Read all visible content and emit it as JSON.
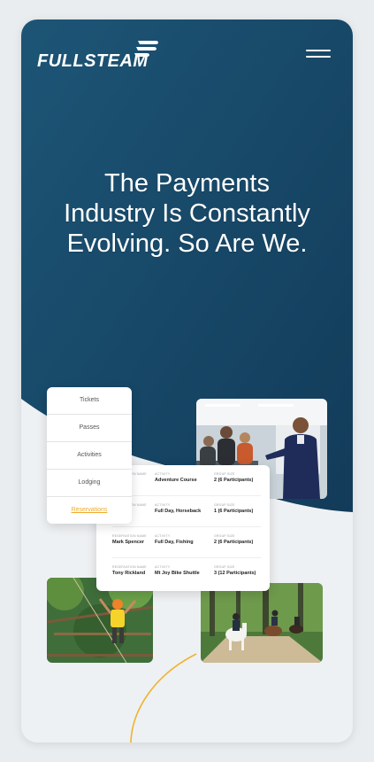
{
  "brand": {
    "logo_text": "FULLSTEAM"
  },
  "hero": {
    "headline": "The Payments Industry Is Constantly Evolving. So Are We."
  },
  "menu_card": {
    "items": [
      {
        "label": "Tickets"
      },
      {
        "label": "Passes"
      },
      {
        "label": "Activities"
      },
      {
        "label": "Lodging"
      },
      {
        "label": "Reservations",
        "active": true
      }
    ]
  },
  "reservations": {
    "caption_name": "RESERVATION NAME",
    "caption_activity": "ACTIVITY",
    "caption_group": "GROUP SIZE",
    "rows": [
      {
        "name": "",
        "activity": "Adventure Course",
        "group": "2 (6 Participants)"
      },
      {
        "name": "",
        "activity": "Full Day, Horseback",
        "group": "1 (6 Participants)"
      },
      {
        "name": "Mark Spencer",
        "activity": "Full Day, Fishing",
        "group": "2 (6 Participants)"
      },
      {
        "name": "Tony Rickland",
        "activity": "Mt Joy Bike Shuttle",
        "group": "3 (12 Participants)"
      }
    ]
  },
  "icons": {
    "menu": "hamburger-menu-icon",
    "logo_mark": "flag-logo-icon"
  },
  "colors": {
    "hero_top": "#1d5576",
    "hero_bottom": "#133e5c",
    "accent": "#f0a92b",
    "background": "#eef1f3"
  }
}
